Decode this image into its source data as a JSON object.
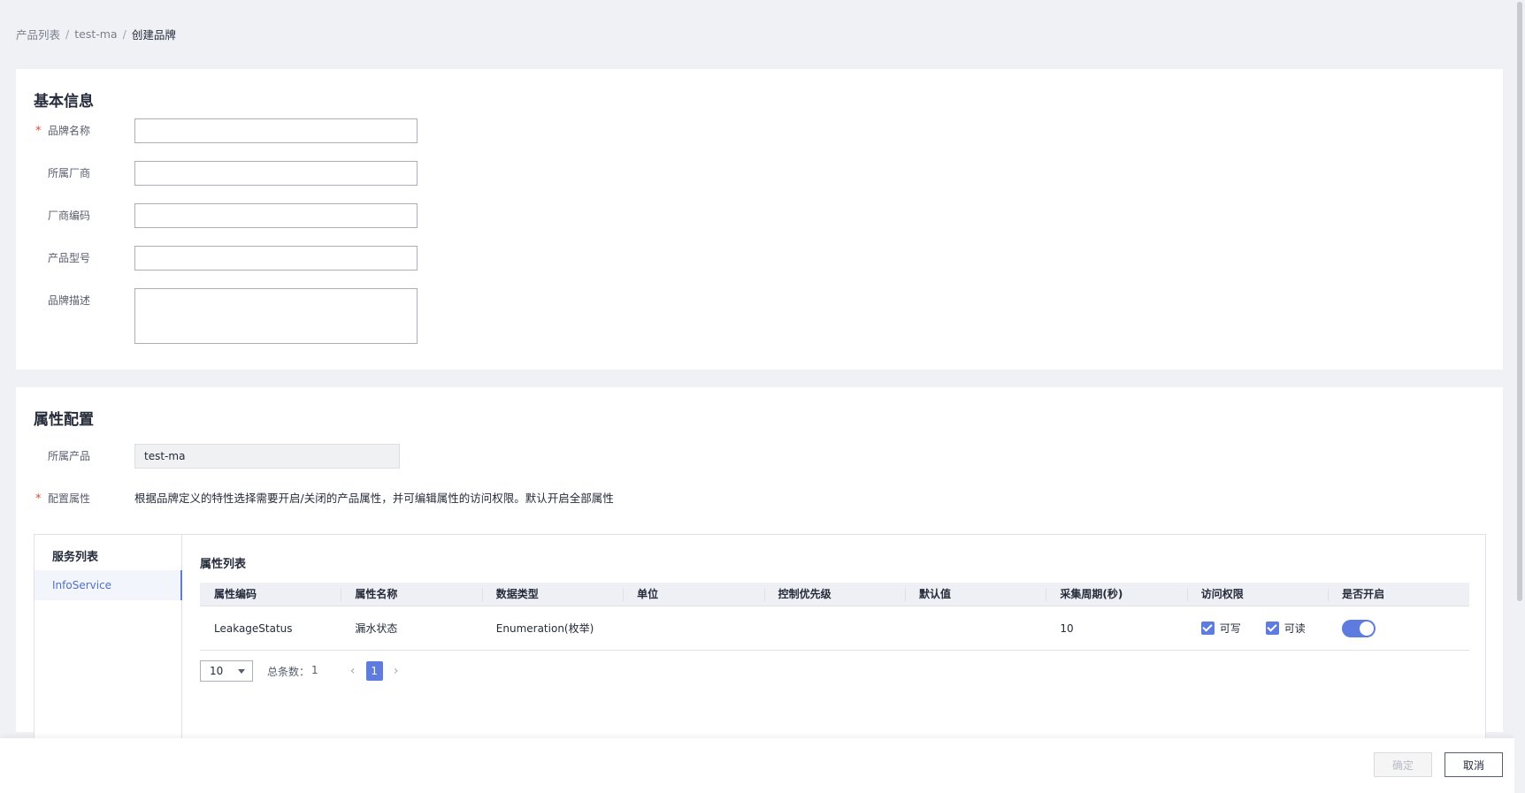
{
  "breadcrumb": {
    "items": [
      "产品列表",
      "test-ma"
    ],
    "separator": "/",
    "current": "创建品牌"
  },
  "basic_info": {
    "title": "基本信息",
    "fields": {
      "brand_name": {
        "label": "品牌名称",
        "value": "",
        "required": "*"
      },
      "manufacturer": {
        "label": "所属厂商",
        "value": ""
      },
      "manufacturer_code": {
        "label": "厂商编码",
        "value": ""
      },
      "product_model": {
        "label": "产品型号",
        "value": ""
      },
      "brand_desc": {
        "label": "品牌描述",
        "value": ""
      }
    }
  },
  "attr_config": {
    "title": "属性配置",
    "product": {
      "label": "所属产品",
      "value": "test-ma"
    },
    "config": {
      "label": "配置属性",
      "required": "*",
      "hint": "根据品牌定义的特性选择需要开启/关闭的产品属性，并可编辑属性的访问权限。默认开启全部属性"
    },
    "service_list": {
      "title": "服务列表",
      "items": [
        "InfoService"
      ]
    },
    "attr_list": {
      "title": "属性列表",
      "columns": [
        "属性编码",
        "属性名称",
        "数据类型",
        "单位",
        "控制优先级",
        "默认值",
        "采集周期(秒)",
        "访问权限",
        "是否开启"
      ],
      "rows": [
        {
          "code": "LeakageStatus",
          "name": "漏水状态",
          "type": "Enumeration(枚举)",
          "unit": "",
          "priority": "",
          "default": "",
          "period": "10",
          "perm_write": "可写",
          "perm_read": "可读",
          "enabled": true
        }
      ]
    },
    "pager": {
      "page_size": "10",
      "total_label": "总条数：",
      "total": "1",
      "current_page": "1"
    }
  },
  "footer": {
    "ok_label": "确定",
    "cancel_label": "取消"
  },
  "colors": {
    "accent": "#5e7ce0",
    "required": "#e0483a",
    "background": "#f0f1f5"
  }
}
